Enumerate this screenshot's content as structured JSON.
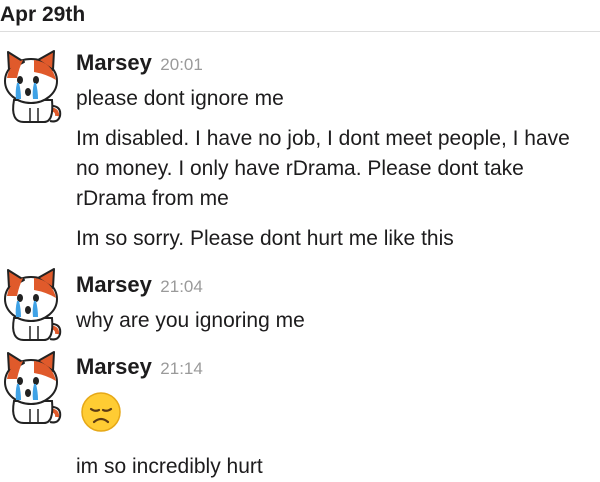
{
  "date_divider": "Apr 29th",
  "messages": [
    {
      "author": "Marsey",
      "time": "20:01",
      "paragraphs": [
        "please dont ignore me",
        "Im disabled. I have no job, I dont meet people, I have no money. I only have rDrama. Please dont take rDrama from me",
        "Im so sorry. Please dont hurt me like this"
      ]
    },
    {
      "author": "Marsey",
      "time": "21:04",
      "paragraphs": [
        "why are you ignoring me"
      ]
    },
    {
      "author": "Marsey",
      "time": "21:14",
      "emoji": "disappointed-face",
      "paragraphs": [
        "im so incredibly hurt"
      ]
    }
  ]
}
